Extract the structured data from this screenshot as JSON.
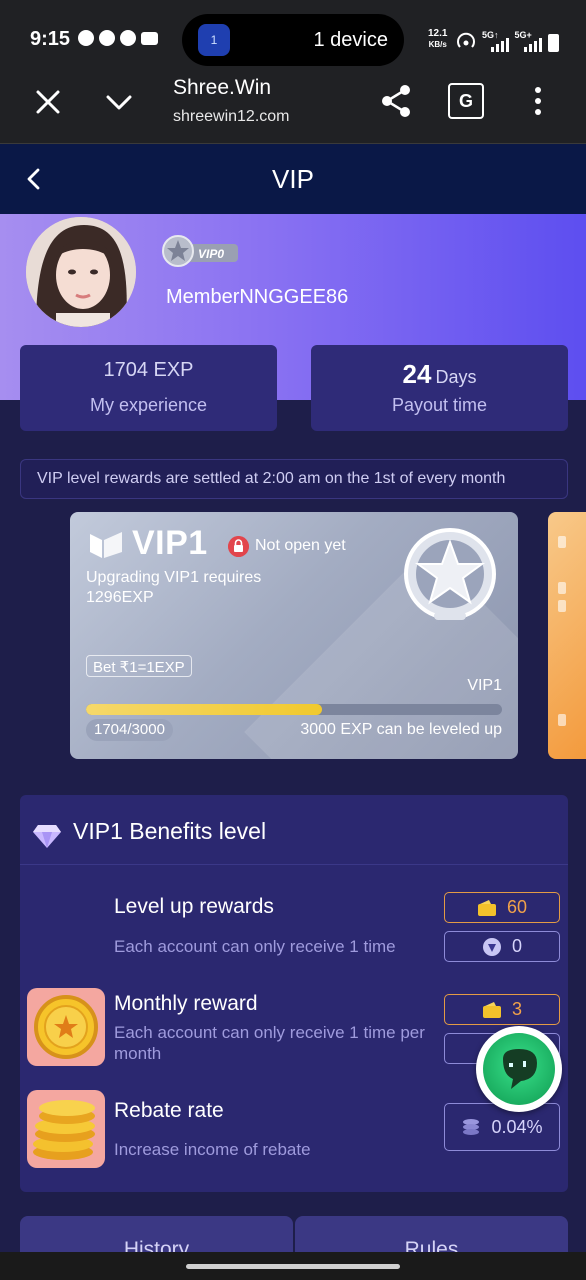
{
  "status_bar": {
    "time": "9:15",
    "live_activity": "1 device",
    "live_activity_badge": "1",
    "net_speed_value": "12.1",
    "net_speed_unit": "KB/s",
    "sim1_label": "5G↑",
    "sim2_label": "5G+",
    "icons": [
      "telegram-icon",
      "chat-icon",
      "whatsapp-icon",
      "discord-icon",
      "hotspot-icon",
      "signal-icon",
      "battery-icon"
    ]
  },
  "browser": {
    "title": "Shree.Win",
    "url": "shreewin12.com",
    "translate_glyph": "G"
  },
  "page": {
    "title": "VIP"
  },
  "profile": {
    "username": "MemberNNGGEE86",
    "vip_badge": "VIP0"
  },
  "stats": {
    "experience_value": "1704 EXP",
    "experience_label": "My experience",
    "payout_value": "24",
    "payout_unit": "Days",
    "payout_label": "Payout time"
  },
  "notice": "VIP level rewards are settled at 2:00 am on the 1st of every month",
  "vip_card": {
    "title": "VIP1",
    "status": "Not open yet",
    "requirement_line1": "Upgrading VIP1 requires",
    "requirement_line2": "1296EXP",
    "bet_rule": "Bet ₹1=1EXP",
    "level_label": "VIP1",
    "progress_text": "1704/3000",
    "progress_fraction": 0.568,
    "level_hint": "3000 EXP can be leveled up"
  },
  "benefits": {
    "title": "VIP1 Benefits level",
    "items": [
      {
        "name": "Level up rewards",
        "description": "Each account can only receive 1 time",
        "values": [
          "60",
          "0"
        ]
      },
      {
        "name": "Monthly reward",
        "description": "Each account can only receive 1 time per month",
        "values": [
          "3",
          ""
        ]
      },
      {
        "name": "Rebate rate",
        "description": "Increase income of rebate",
        "values": [
          "0.04%"
        ]
      }
    ]
  },
  "tabs": [
    "History",
    "Rules"
  ],
  "colors": {
    "page_bg": "#1e1e4a",
    "header_bg": "#0a1847",
    "hero_start": "#a68ef0",
    "hero_end": "#5d4ef0",
    "card_bg": "#2f2b78",
    "accent_gold": "#f1a24a",
    "progress_fill": "#f1c92e"
  }
}
